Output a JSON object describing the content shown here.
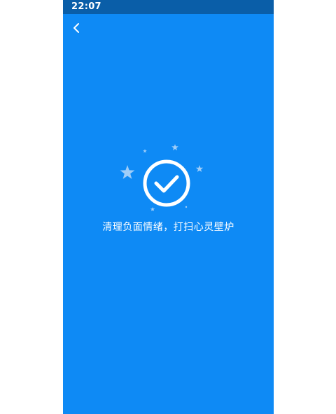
{
  "status_bar": {
    "time": "22:07"
  },
  "nav": {
    "back_icon": "chevron-left-icon"
  },
  "result": {
    "icon": "checkmark-circle-icon",
    "decoration_icon": "star-icon",
    "message": "清理负面情绪，打扫心灵壁炉"
  },
  "colors": {
    "background": "#0e8af5",
    "status_bar": "#0a5ea8",
    "foreground": "#ffffff",
    "star": "#9fcdf8"
  }
}
